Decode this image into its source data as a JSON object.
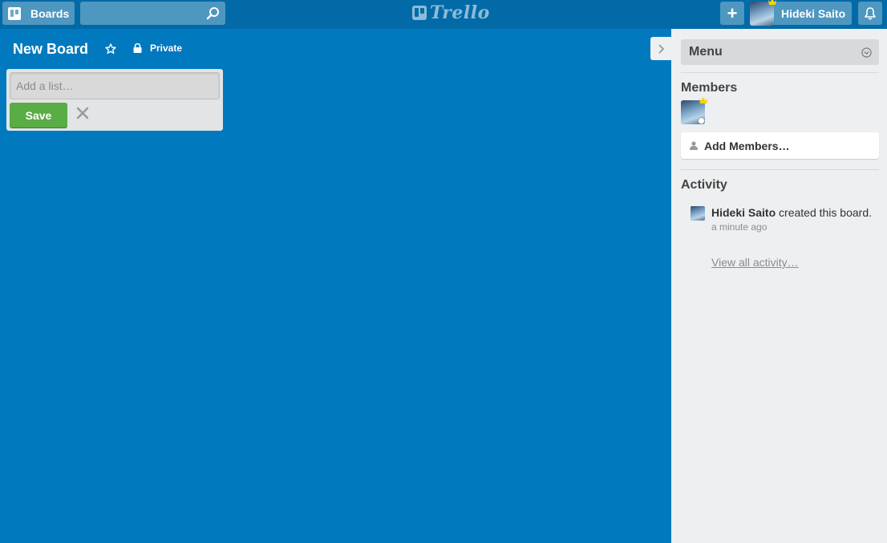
{
  "header": {
    "boards_label": "Boards",
    "search_value": "",
    "logo_text": "Trello",
    "add_symbol": "+",
    "user_name": "Hideki Saito"
  },
  "board": {
    "title": "New Board",
    "visibility": "Private"
  },
  "composer": {
    "placeholder": "Add a list…",
    "save_label": "Save"
  },
  "sidebar": {
    "menu_title": "Menu",
    "members_title": "Members",
    "add_members_label": "Add Members…",
    "activity_title": "Activity",
    "activity": [
      {
        "who": "Hideki Saito",
        "action": " created this board.",
        "time": "a minute ago"
      }
    ],
    "view_all_label": "View all activity…"
  },
  "colors": {
    "board_bg": "#0079bf",
    "header_bg": "#026aa7",
    "save_green": "#5aac44",
    "sidebar_bg": "#edeff0"
  },
  "icons": [
    "board-icon",
    "search-icon",
    "trello-logo-icon",
    "plus-icon",
    "crown-icon",
    "bell-icon",
    "star-icon",
    "lock-icon",
    "close-icon",
    "chevron-right-icon",
    "chevron-down-circle-icon",
    "person-icon"
  ]
}
